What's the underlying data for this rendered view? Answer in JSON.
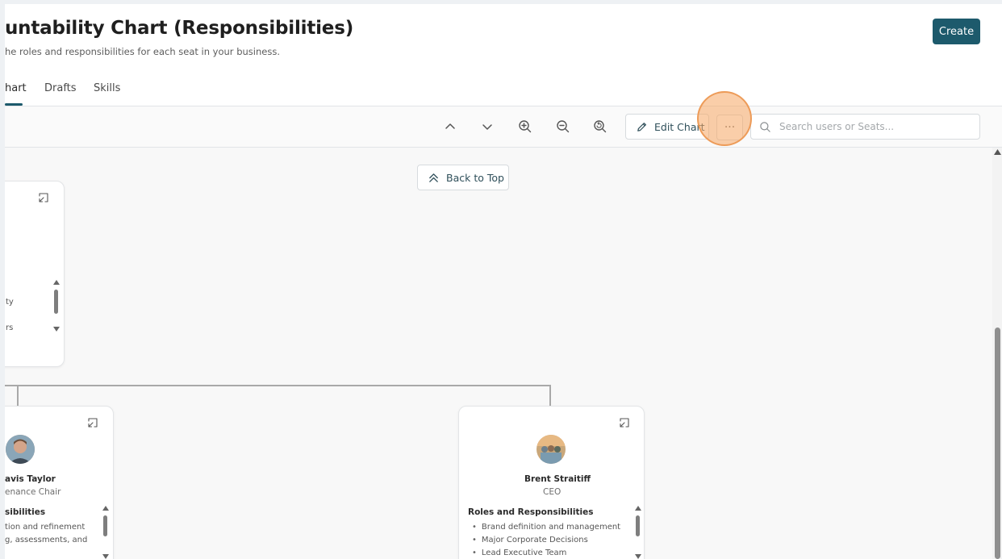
{
  "header": {
    "title": "untability Chart (Responsibilities)",
    "subtitle": "he roles and responsibilities for each seat in your business.",
    "create_label": "Create"
  },
  "tabs": [
    {
      "label": "hart",
      "active": true
    },
    {
      "label": "Drafts",
      "active": false
    },
    {
      "label": "Skills",
      "active": false
    }
  ],
  "toolbar": {
    "edit_chart_label": "Edit Chart",
    "more_label": "···",
    "search_placeholder": "Search users or Seats..."
  },
  "canvas": {
    "back_to_top_label": "Back to Top"
  },
  "cards": {
    "top_left": {
      "fragments": [
        "ty",
        "rs"
      ]
    },
    "left": {
      "name": "avis Taylor",
      "seat": "enance Chair",
      "roles_heading": "sibilities",
      "roles": [
        "tion and refinement",
        "g, assessments, and"
      ]
    },
    "ceo": {
      "name": "Brent Straitiff",
      "seat": "CEO",
      "roles_heading": "Roles and Responsibilities",
      "roles": [
        "Brand definition and management",
        "Major Corporate Decisions",
        "Lead Executive Team"
      ]
    }
  },
  "colors": {
    "brand": "#1d5a6c",
    "highlight": "#f5a662",
    "connector": "#a9a9a9"
  }
}
